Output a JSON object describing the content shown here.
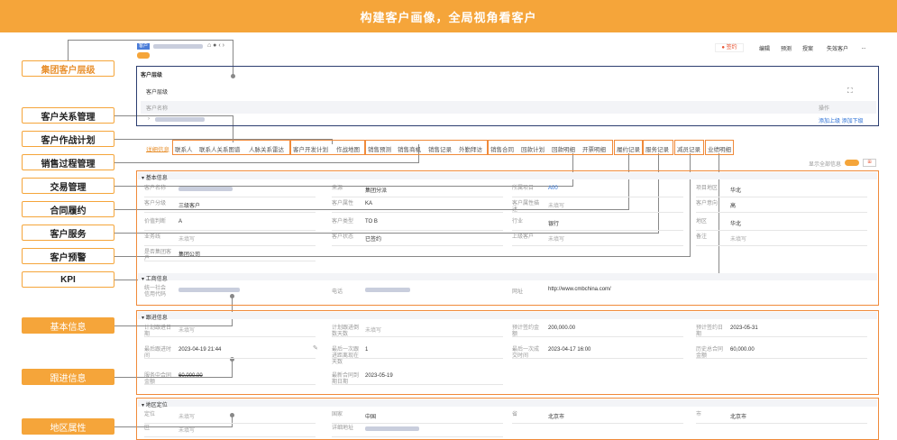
{
  "banner": "构建客户画像，全局视角看客户",
  "labels": {
    "group_level": "集团客户层级",
    "relation": "客户关系管理",
    "battle": "客户作战计划",
    "sales": "销售过程管理",
    "trade": "交易管理",
    "contract": "合同履约",
    "service": "客户服务",
    "warning": "客户预警",
    "kpi": "KPI",
    "basic": "基本信息",
    "follow": "跟进信息",
    "region": "地区属性"
  },
  "header": {
    "tag": "客户",
    "status": "● 签约",
    "buttons": [
      "编辑",
      "预测",
      "授案",
      "失效客户",
      "..."
    ]
  },
  "hierarchy": {
    "title": "客户层级",
    "subtitle": "客户层级",
    "col_name": "客户名称",
    "col_op": "操作",
    "op_links": "添加上级 添加下级"
  },
  "tabs": [
    "详细信息",
    "联系人",
    "联系人关系图谱",
    "人脉关系雷达",
    "客户开发计划",
    "作战地图",
    "销售预测",
    "销售商机",
    "销售记录",
    "外勤拜访",
    "销售合同",
    "回款计划",
    "回款明细",
    "开票明细",
    "履约记录",
    "服务记录",
    "减员记录",
    "业绩明细"
  ],
  "show_all": "显示全部信息",
  "basic_info": {
    "title": "基本信息",
    "fields": [
      {
        "k": "客户名称",
        "v": ""
      },
      {
        "k": "来源",
        "v": "集团分派"
      },
      {
        "k": "所属项目",
        "v": "A00"
      },
      {
        "k": "项目地区",
        "v": "华北"
      },
      {
        "k": "客户分级",
        "v": "三级客户"
      },
      {
        "k": "客户属性",
        "v": "KA"
      },
      {
        "k": "客户属性描述",
        "v": "未填写"
      },
      {
        "k": "客户意向",
        "v": "高"
      },
      {
        "k": "价值判断",
        "v": "A"
      },
      {
        "k": "客户类型",
        "v": "TO B"
      },
      {
        "k": "行业",
        "v": "银行"
      },
      {
        "k": "地区",
        "v": "华北"
      },
      {
        "k": "业务线",
        "v": "未填写"
      },
      {
        "k": "客户状态",
        "v": "已签约"
      },
      {
        "k": "上级客户",
        "v": "未填写"
      },
      {
        "k": "备注",
        "v": "未填写"
      },
      {
        "k": "是否集团客户",
        "v": "集团公司"
      }
    ]
  },
  "business_info": {
    "title": "工商信息",
    "fields": [
      {
        "k": "统一社会信用代码",
        "v": ""
      },
      {
        "k": "电话",
        "v": ""
      },
      {
        "k": "网址",
        "v": "http://www.cmbchina.com/"
      }
    ]
  },
  "follow_info": {
    "title": "跟进信息",
    "fields": [
      {
        "k": "计划跟进日期",
        "v": "未填写"
      },
      {
        "k": "计划跟进倒数天数",
        "v": "未填写"
      },
      {
        "k": "预计签约金额",
        "v": "200,000.00"
      },
      {
        "k": "预计签约日期",
        "v": "2023-05-31"
      },
      {
        "k": "最后跟进时间",
        "v": "2023-04-19 21:44"
      },
      {
        "k": "最后一次跟进距离现在天数",
        "v": "1"
      },
      {
        "k": "最后一次成交时间",
        "v": "2023-04-17 16:00"
      },
      {
        "k": "历史总合同金额",
        "v": "60,000.00"
      },
      {
        "k": "服务中合同金额",
        "v": "60,000.00"
      },
      {
        "k": "最新合同到期日期",
        "v": "2023-05-19"
      }
    ]
  },
  "region_info": {
    "title": "地区定位",
    "fields": [
      {
        "k": "定位",
        "v": "未填写"
      },
      {
        "k": "国家",
        "v": "中国"
      },
      {
        "k": "省",
        "v": "北京市"
      },
      {
        "k": "市",
        "v": "北京市"
      },
      {
        "k": "区",
        "v": "未填写"
      },
      {
        "k": "详细地址",
        "v": ""
      }
    ]
  }
}
